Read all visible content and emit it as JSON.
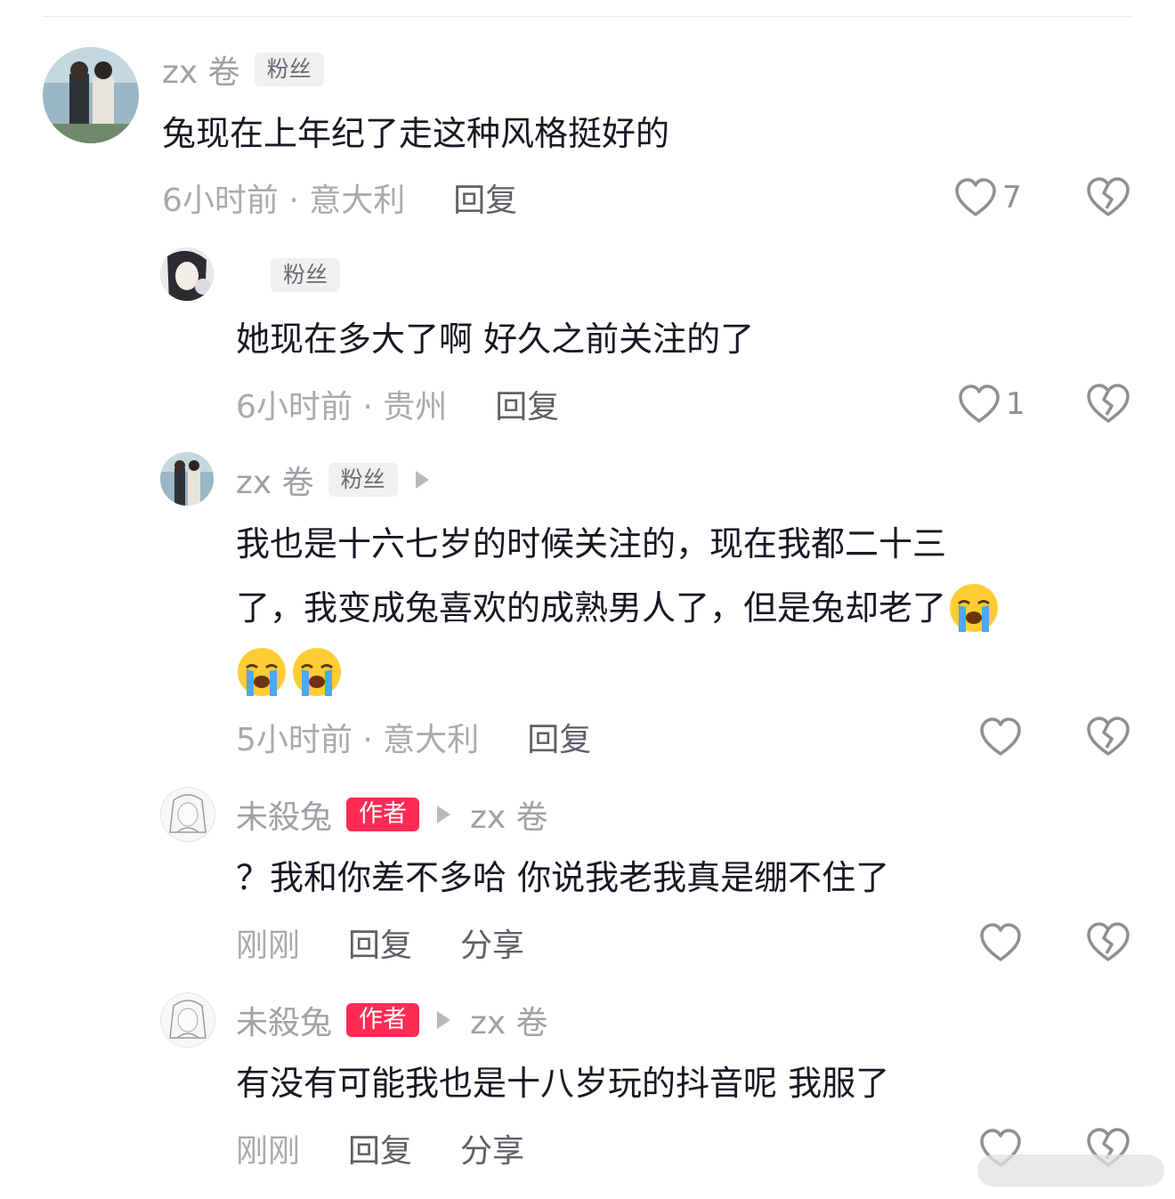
{
  "comments": [
    {
      "user": "zx 卷",
      "badge": "粉丝",
      "reply_to": "",
      "text_lines": [
        "兔现在上年纪了走这种风格挺好的"
      ],
      "time_location": "6小时前 · 意大利",
      "reply_label": "回复",
      "share_label": "",
      "like_count": "7"
    },
    {
      "user": "",
      "badge": "粉丝",
      "reply_to": "",
      "text_lines": [
        "她现在多大了啊 好久之前关注的了"
      ],
      "time_location": "6小时前 · 贵州",
      "reply_label": "回复",
      "share_label": "",
      "like_count": "1"
    },
    {
      "user": "zx 卷",
      "badge": "粉丝",
      "reply_to": "",
      "text_lines": [
        "我也是十六七岁的时候关注的，现在我都二十三",
        "了，我变成兔喜欢的成熟男人了，但是兔却老了",
        ""
      ],
      "emojis": [
        "loudly-crying-face",
        "loudly-crying-face",
        "loudly-crying-face"
      ],
      "time_location": "5小时前 · 意大利",
      "reply_label": "回复",
      "share_label": "",
      "like_count": ""
    },
    {
      "user": "未殺兔",
      "badge": "作者",
      "reply_to": "zx 卷",
      "text_lines": [
        "？我和你差不多哈 你说我老我真是绷不住了"
      ],
      "time_location": "刚刚",
      "reply_label": "回复",
      "share_label": "分享",
      "like_count": ""
    },
    {
      "user": "未殺兔",
      "badge": "作者",
      "reply_to": "zx 卷",
      "text_lines": [
        "有没有可能我也是十八岁玩的抖音呢 我服了"
      ],
      "time_location": "刚刚",
      "reply_label": "回复",
      "share_label": "分享",
      "like_count": ""
    }
  ],
  "colors": {
    "author_badge": "#fe2c55",
    "muted_text": "#a0a0a6",
    "body_text": "#161823"
  },
  "icons": [
    "heart-outline-icon",
    "broken-heart-icon",
    "play-triangle-icon",
    "loudly-crying-face-emoji"
  ]
}
